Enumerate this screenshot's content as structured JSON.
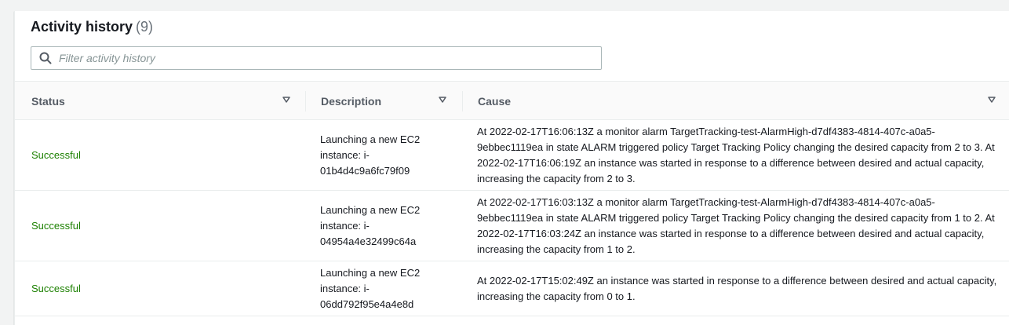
{
  "header": {
    "title": "Activity history",
    "count": "(9)"
  },
  "search": {
    "placeholder": "Filter activity history",
    "icon": "search-icon"
  },
  "columns": [
    {
      "label": "Status",
      "icon": "sort-caret-icon"
    },
    {
      "label": "Description",
      "icon": "sort-caret-icon"
    },
    {
      "label": "Cause",
      "icon": "sort-caret-icon"
    }
  ],
  "rows": [
    {
      "status": "Successful",
      "description": "Launching a new EC2 instance: i-01b4d4c9a6fc79f09",
      "cause": "At 2022-02-17T16:06:13Z a monitor alarm TargetTracking-test-AlarmHigh-d7df4383-4814-407c-a0a5-9ebbec1119ea in state ALARM triggered policy Target Tracking Policy changing the desired capacity from 2 to 3. At 2022-02-17T16:06:19Z an instance was started in response to a difference between desired and actual capacity, increasing the capacity from 2 to 3."
    },
    {
      "status": "Successful",
      "description": "Launching a new EC2 instance: i-04954a4e32499c64a",
      "cause": "At 2022-02-17T16:03:13Z a monitor alarm TargetTracking-test-AlarmHigh-d7df4383-4814-407c-a0a5-9ebbec1119ea in state ALARM triggered policy Target Tracking Policy changing the desired capacity from 1 to 2. At 2022-02-17T16:03:24Z an instance was started in response to a difference between desired and actual capacity, increasing the capacity from 1 to 2."
    },
    {
      "status": "Successful",
      "description": "Launching a new EC2 instance: i-06dd792f95e4a4e8d",
      "cause": "At 2022-02-17T15:02:49Z an instance was started in response to a difference between desired and actual capacity, increasing the capacity from 0 to 1."
    }
  ],
  "colors": {
    "success": "#1d8102",
    "header_bg": "#fafafa",
    "border": "#eaeded"
  }
}
